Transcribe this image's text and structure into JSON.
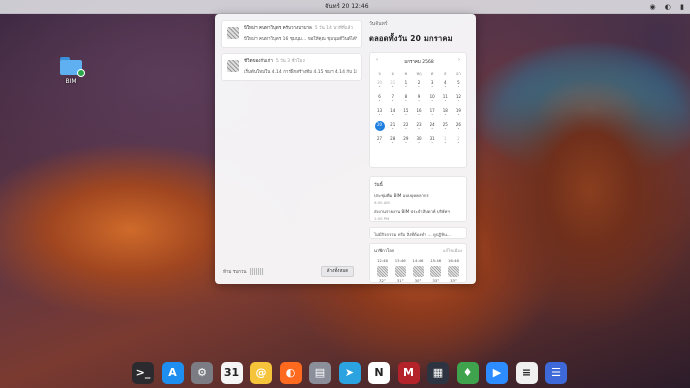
{
  "topbar": {
    "clock": "จันทร์ 20 12:46",
    "menu_glyph": "",
    "tray": {
      "wifi": "◉",
      "volume": "◐",
      "battery": "▮"
    }
  },
  "desktop": {
    "folder_label": "BIM"
  },
  "notifications": [
    {
      "title": "ปีใหม่ฯ คนทาวิบุตร ครับวางบาบาล",
      "time": "5 วัน 14 นาทีที่แล้ว",
      "body": "ปีใหม่ฯ คนทาวิบุตร 16 ชุมนุม... ขอให้คุณ ชุมนุมดีวินด์ได้รัก ขอให้คุณ ..."
    },
    {
      "title": "ชีวิตของกับเก่า",
      "time": "5 วัน 3 ชั่วโมง",
      "body": "เริ่มต้นใหม่ใน 4.14 การฝึกสร้างทีม 4.15 ชมฯ 4.14 กับ 18.40 เบนช์ ..."
    }
  ],
  "dnd_label": "ห้าม รบกวน",
  "clear_label": "ล้างทั้งหมด",
  "date_header": {
    "weekday": "วันจันทร์",
    "date": "ตลอดทั้งวัน 20 มกราคม"
  },
  "calendar": {
    "month": "มกราคม 2568",
    "prev": "‹",
    "next": "›",
    "weekdays": [
      "จ",
      "อ",
      "พ",
      "พฤ",
      "ศ",
      "ส",
      "อา"
    ],
    "weeks": [
      [
        {
          "d": "30",
          "o": true
        },
        {
          "d": "31",
          "o": true
        },
        {
          "d": "1"
        },
        {
          "d": "2"
        },
        {
          "d": "3"
        },
        {
          "d": "4"
        },
        {
          "d": "5"
        }
      ],
      [
        {
          "d": "6"
        },
        {
          "d": "7"
        },
        {
          "d": "8"
        },
        {
          "d": "9"
        },
        {
          "d": "10"
        },
        {
          "d": "11"
        },
        {
          "d": "12"
        }
      ],
      [
        {
          "d": "13"
        },
        {
          "d": "14"
        },
        {
          "d": "15"
        },
        {
          "d": "16"
        },
        {
          "d": "17"
        },
        {
          "d": "18"
        },
        {
          "d": "19"
        }
      ],
      [
        {
          "d": "20",
          "t": true
        },
        {
          "d": "21"
        },
        {
          "d": "22"
        },
        {
          "d": "23"
        },
        {
          "d": "24"
        },
        {
          "d": "25"
        },
        {
          "d": "26"
        }
      ],
      [
        {
          "d": "27"
        },
        {
          "d": "28"
        },
        {
          "d": "29"
        },
        {
          "d": "30"
        },
        {
          "d": "31"
        },
        {
          "d": "1",
          "o": true
        },
        {
          "d": "2",
          "o": true
        }
      ]
    ]
  },
  "schedule": {
    "heading": "วันนี้",
    "events": [
      {
        "title": "ประชุมทีม BIM แบบบุคคลากร",
        "time": "9:00 AM"
      },
      {
        "title": "ส่งงานรายงาน BIM ประจำสัปดาห์ บริษัทฯ",
        "time": "1:00 PM"
      }
    ]
  },
  "todo_text": "ไม่มีกิจกรรม หรือ สิ่งที่ต้องทำ ... ดูปฏิทิน...",
  "world_clock": {
    "title": "นาฬิกาโลก",
    "action": "แก้ไขเมือง",
    "cities": [
      {
        "time": "12:46",
        "temp": "32°"
      },
      {
        "time": "13:46",
        "temp": "31°"
      },
      {
        "time": "14:46",
        "temp": "30°"
      },
      {
        "time": "15:46",
        "temp": "33°"
      },
      {
        "time": "16:46",
        "temp": "33°"
      }
    ]
  },
  "dock": [
    {
      "name": "terminal",
      "glyph": ">_",
      "color": "#2b2b2f"
    },
    {
      "name": "app-store",
      "glyph": "A",
      "color": "#1f8ef1"
    },
    {
      "name": "settings",
      "glyph": "⚙",
      "color": "#7c7c85"
    },
    {
      "name": "calendar",
      "glyph": "31",
      "color": "#f5f5f5"
    },
    {
      "name": "mail",
      "glyph": "@",
      "color": "#f6c43a"
    },
    {
      "name": "firefox",
      "glyph": "◐",
      "color": "#ff6a1f"
    },
    {
      "name": "files",
      "glyph": "▤",
      "color": "#8a8f9a"
    },
    {
      "name": "telegram",
      "glyph": "➤",
      "color": "#2aa3e0"
    },
    {
      "name": "notion",
      "glyph": "N",
      "color": "#ffffff"
    },
    {
      "name": "mendeley",
      "glyph": "M",
      "color": "#b4222a"
    },
    {
      "name": "grid-app",
      "glyph": "▦",
      "color": "#2d3340"
    },
    {
      "name": "frog-app",
      "glyph": "♦",
      "color": "#3fa34d"
    },
    {
      "name": "zoom",
      "glyph": "▶",
      "color": "#2d8cff"
    },
    {
      "name": "reader",
      "glyph": "≡",
      "color": "#f0f0f0"
    },
    {
      "name": "documents",
      "glyph": "☰",
      "color": "#3d6ad8"
    }
  ]
}
